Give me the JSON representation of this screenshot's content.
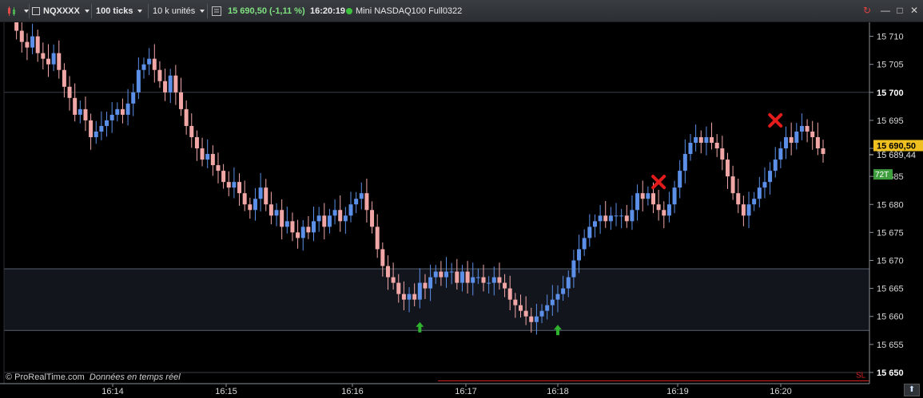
{
  "toolbar": {
    "symbol": "NQXXXX",
    "interval": "100 ticks",
    "volume_units": "10 k unités",
    "price_change": "15 690,50 (-1,11 %)",
    "time": "16:20:19",
    "instrument": "Mini NASDAQ100 Full0322"
  },
  "footer": {
    "copyright": "© ProRealTime.com",
    "realtime_label": "Données en temps réel"
  },
  "stop_loss_label": "SL",
  "price_labels": {
    "current": "15 690,50",
    "second": "15 689,44",
    "ticks_counter": "72T"
  },
  "colors": {
    "bull": "#5b8fe8",
    "bear": "#f2a7a7",
    "current_price_bg": "#f0c020",
    "ticks_bg": "#3e9e3e",
    "stop_loss_line": "#d02020",
    "zone_fill": "#13151c",
    "buy_arrow": "#2fb32f",
    "sell_marker": "#e21b1b"
  },
  "chart_data": {
    "type": "candlestick",
    "y_axis_ticks": [
      15710,
      15705,
      15700,
      15695,
      15690,
      15685,
      15680,
      15675,
      15670,
      15665,
      15660,
      15655,
      15650
    ],
    "y_axis_labels": [
      "15 710",
      "15 705",
      "15 700",
      "15 695",
      "15 690",
      "15 685",
      "15 680",
      "15 675",
      "15 670",
      "15 665",
      "15 660",
      "15 655",
      "15 650"
    ],
    "x_axis_labels": [
      "16:14",
      "16:15",
      "16:16",
      "16:17",
      "16:18",
      "16:19",
      "16:20"
    ],
    "ylim": [
      15648,
      15712.5
    ],
    "horizontal_lines": [
      15700,
      15650
    ],
    "zone": [
      15657.5,
      15668.5
    ],
    "stop_loss": 15648.5,
    "candle_closes": [
      15714,
      15711,
      15709,
      15708,
      15710,
      15707,
      15706,
      15705,
      15707,
      15704,
      15701,
      15699,
      15696,
      15697,
      15695,
      15692,
      15693,
      15694,
      15695,
      15696,
      15697,
      15696,
      15698,
      15700,
      15704,
      15705,
      15706,
      15704,
      15702,
      15700,
      15703,
      15700,
      15697,
      15694,
      15692,
      15690,
      15688,
      15689,
      15687,
      15686,
      15684,
      15683,
      15684,
      15682,
      15680,
      15679,
      15681,
      15683,
      15680,
      15678,
      15679,
      15676,
      15677,
      15675,
      15674,
      15676,
      15675,
      15677,
      15678,
      15676,
      15678,
      15679,
      15677,
      15678,
      15680,
      15681,
      15682,
      15679,
      15676,
      15672,
      15669,
      15667,
      15666,
      15664,
      15663,
      15664,
      15663,
      15666,
      15665,
      15667,
      15668,
      15667,
      15668,
      15668,
      15666,
      15668,
      15666,
      15667,
      15667,
      15666,
      15666,
      15667,
      15666,
      15665,
      15663,
      15662,
      15661,
      15660,
      15659,
      15660,
      15661,
      15662,
      15663,
      15664,
      15665,
      15667,
      15670,
      15672,
      15674,
      15676,
      15677,
      15678,
      15677,
      15678,
      15678,
      15678,
      15677,
      15679,
      15682,
      15681,
      15682,
      15680,
      15679,
      15678,
      15680,
      15683,
      15686,
      15689,
      15691,
      15692,
      15691,
      15692,
      15691,
      15690,
      15688,
      15685,
      15682,
      15680,
      15678,
      15680,
      15681,
      15683,
      15684,
      15686,
      15688,
      15690,
      15692,
      15691,
      15693,
      15694,
      15693,
      15692,
      15690,
      15689
    ],
    "buy_signals": [
      {
        "x_index": 77,
        "y": 15660
      },
      {
        "x_index": 103,
        "y": 15659.5
      }
    ],
    "sell_signals": [
      {
        "x_index": 122,
        "y": 15684
      },
      {
        "x_index": 144,
        "y": 15695
      }
    ]
  }
}
